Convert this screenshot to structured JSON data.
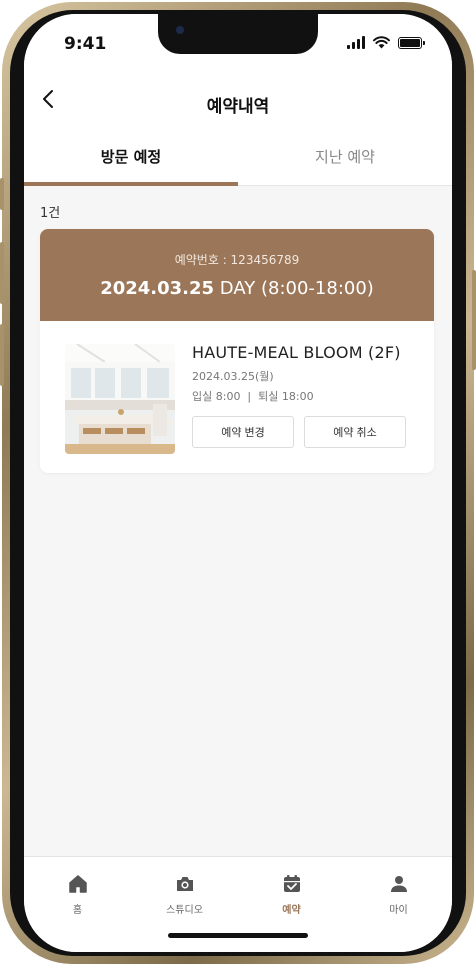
{
  "status_bar": {
    "time": "9:41"
  },
  "header": {
    "title": "예약내역"
  },
  "tabs": [
    {
      "label": "방문 예정",
      "active": true
    },
    {
      "label": "지난 예약",
      "active": false
    }
  ],
  "list": {
    "count": "1건"
  },
  "reservation": {
    "number": "예약번호 : 123456789",
    "date": "2024.03.25",
    "date_suffix": "DAY (8:00-18:00)",
    "studio_name": "HAUTE-MEAL BLOOM (2F)",
    "visit_date": "2024.03.25(월)",
    "checkin_checkout": "입실 8:00  |  퇴실 18:00",
    "change_label": "예약 변경",
    "cancel_label": "예약 취소"
  },
  "bottom_nav": [
    {
      "label": "홈",
      "icon": "home-icon",
      "active": false
    },
    {
      "label": "스튜디오",
      "icon": "camera-icon",
      "active": false
    },
    {
      "label": "예약",
      "icon": "calendar-check-icon",
      "active": true
    },
    {
      "label": "마이",
      "icon": "person-icon",
      "active": false
    }
  ],
  "colors": {
    "accent": "#9b7658",
    "background": "#f6f6f6"
  }
}
